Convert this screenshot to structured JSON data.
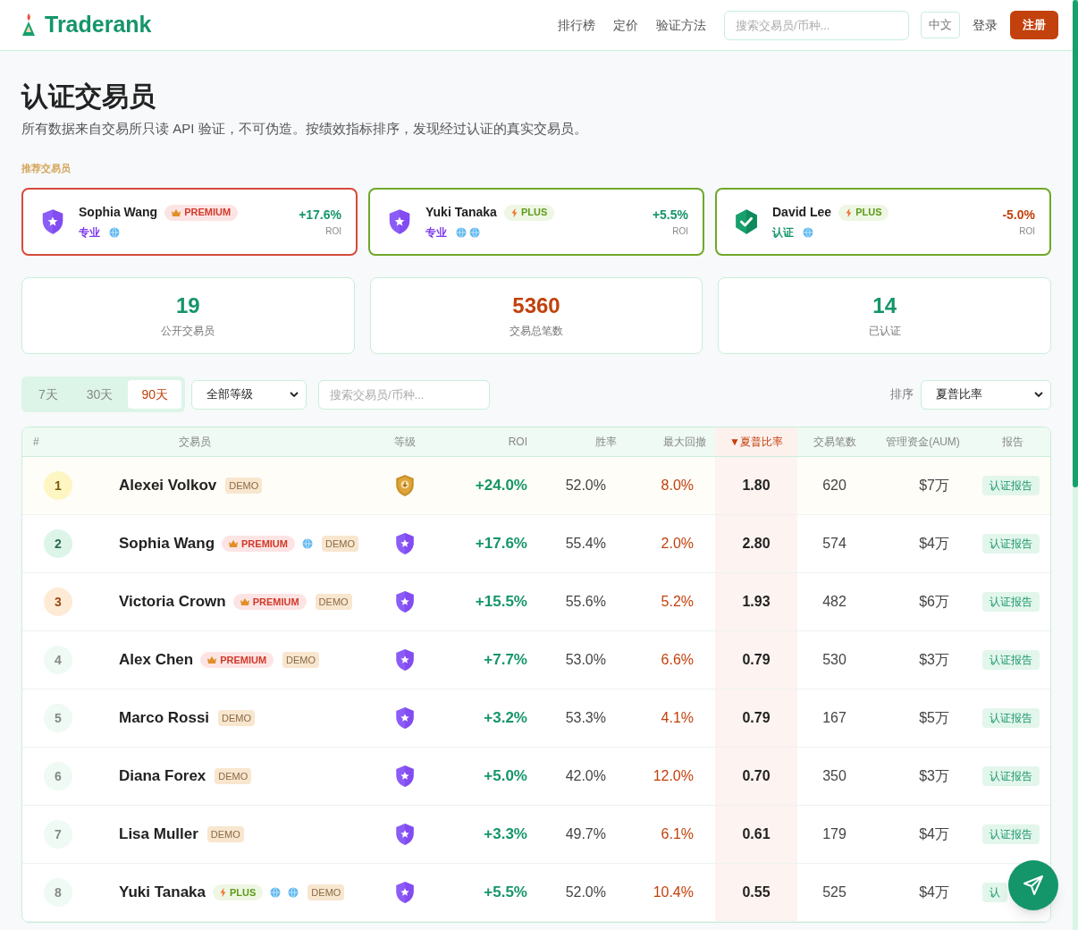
{
  "header": {
    "logo": "Traderank",
    "nav": [
      "排行榜",
      "定价",
      "验证方法"
    ],
    "search": {
      "placeholder": "搜索交易员/币种..."
    },
    "language": "中文",
    "login": "登录",
    "signup": "注册"
  },
  "page": {
    "title": "认证交易员",
    "subtitle": "所有数据来自交易所只读 API 验证，不可伪造。按绩效指标排序，发现经过认证的真实交易员。"
  },
  "featured": {
    "label": "推荐交易员",
    "cards": [
      {
        "name": "Sophia Wang",
        "badge": {
          "kind": "premium",
          "label": "PREMIUM"
        },
        "tier": {
          "kind": "pro",
          "label": "专业"
        },
        "icons": [
          {
            "kind": "globe"
          }
        ],
        "roi": "+17.6%",
        "roi_label": "ROI",
        "negative": false
      },
      {
        "name": "Yuki Tanaka",
        "badge": {
          "kind": "plus",
          "label": "PLUS"
        },
        "tier": {
          "kind": "pro",
          "label": "专业"
        },
        "icons": [
          {
            "kind": "globe"
          },
          {
            "kind": "globe"
          }
        ],
        "roi": "+5.5%",
        "roi_label": "ROI",
        "negative": false
      },
      {
        "name": "David Lee",
        "badge": {
          "kind": "plus",
          "label": "PLUS"
        },
        "tier": {
          "kind": "verified",
          "label": "认证"
        },
        "icons": [
          {
            "kind": "globe"
          }
        ],
        "roi": "-5.0%",
        "roi_label": "ROI",
        "negative": true
      }
    ]
  },
  "stats": [
    {
      "value": "19",
      "label": "公开交易员",
      "color": "#15956a"
    },
    {
      "value": "5360",
      "label": "交易总笔数",
      "color": "#c2410c"
    },
    {
      "value": "14",
      "label": "已认证",
      "color": "#15956a"
    }
  ],
  "filters": {
    "period_tabs": [
      {
        "label": "7天",
        "selected": false
      },
      {
        "label": "30天",
        "selected": false
      },
      {
        "label": "90天",
        "selected": true
      }
    ],
    "level_select": "全部等级",
    "search": {
      "placeholder": "搜索交易员/币种..."
    },
    "sort_label": "排序",
    "sort_select": "夏普比率"
  },
  "table": {
    "sort_mark": "▼",
    "columns": [
      {
        "label": "#",
        "sorted": false
      },
      {
        "label": "交易员",
        "sorted": false
      },
      {
        "label": "等级",
        "sorted": false
      },
      {
        "label": "ROI",
        "sorted": false
      },
      {
        "label": "胜率",
        "sorted": false
      },
      {
        "label": "最大回撤",
        "sorted": false
      },
      {
        "label": "夏普比率",
        "sorted": true
      },
      {
        "label": "交易笔数",
        "sorted": false
      },
      {
        "label": "管理资金(AUM)",
        "sorted": false
      },
      {
        "label": "报告",
        "sorted": false
      }
    ],
    "rows": [
      {
        "rank": "1",
        "name": "Alexei Volkov",
        "tags": [
          {
            "kind": "demo",
            "label": "DEMO"
          }
        ],
        "tier": {
          "kind": "gold"
        },
        "roi": "+24.0%",
        "win_rate": "52.0%",
        "max_drawdown": "8.0%",
        "sharpe": "1.80",
        "trades": "620",
        "aum": "$7万",
        "report": "认证报告"
      },
      {
        "rank": "2",
        "name": "Sophia Wang",
        "tags": [
          {
            "kind": "premium",
            "label": "PREMIUM"
          },
          {
            "kind": "globe"
          },
          {
            "kind": "demo",
            "label": "DEMO"
          }
        ],
        "tier": {
          "kind": "pro"
        },
        "roi": "+17.6%",
        "win_rate": "55.4%",
        "max_drawdown": "2.0%",
        "sharpe": "2.80",
        "trades": "574",
        "aum": "$4万",
        "report": "认证报告"
      },
      {
        "rank": "3",
        "name": "Victoria Crown",
        "tags": [
          {
            "kind": "premium",
            "label": "PREMIUM"
          },
          {
            "kind": "demo",
            "label": "DEMO"
          }
        ],
        "tier": {
          "kind": "pro"
        },
        "roi": "+15.5%",
        "win_rate": "55.6%",
        "max_drawdown": "5.2%",
        "sharpe": "1.93",
        "trades": "482",
        "aum": "$6万",
        "report": "认证报告"
      },
      {
        "rank": "4",
        "name": "Alex Chen",
        "tags": [
          {
            "kind": "premium",
            "label": "PREMIUM"
          },
          {
            "kind": "demo",
            "label": "DEMO"
          }
        ],
        "tier": {
          "kind": "pro"
        },
        "roi": "+7.7%",
        "win_rate": "53.0%",
        "max_drawdown": "6.6%",
        "sharpe": "0.79",
        "trades": "530",
        "aum": "$3万",
        "report": "认证报告"
      },
      {
        "rank": "5",
        "name": "Marco Rossi",
        "tags": [
          {
            "kind": "demo",
            "label": "DEMO"
          }
        ],
        "tier": {
          "kind": "pro"
        },
        "roi": "+3.2%",
        "win_rate": "53.3%",
        "max_drawdown": "4.1%",
        "sharpe": "0.79",
        "trades": "167",
        "aum": "$5万",
        "report": "认证报告"
      },
      {
        "rank": "6",
        "name": "Diana Forex",
        "tags": [
          {
            "kind": "demo",
            "label": "DEMO"
          }
        ],
        "tier": {
          "kind": "pro"
        },
        "roi": "+5.0%",
        "win_rate": "42.0%",
        "max_drawdown": "12.0%",
        "sharpe": "0.70",
        "trades": "350",
        "aum": "$3万",
        "report": "认证报告"
      },
      {
        "rank": "7",
        "name": "Lisa Muller",
        "tags": [
          {
            "kind": "demo",
            "label": "DEMO"
          }
        ],
        "tier": {
          "kind": "pro"
        },
        "roi": "+3.3%",
        "win_rate": "49.7%",
        "max_drawdown": "6.1%",
        "sharpe": "0.61",
        "trades": "179",
        "aum": "$4万",
        "report": "认证报告"
      },
      {
        "rank": "8",
        "name": "Yuki Tanaka",
        "tags": [
          {
            "kind": "plus",
            "label": "PLUS"
          },
          {
            "kind": "globe"
          },
          {
            "kind": "globe"
          },
          {
            "kind": "demo",
            "label": "DEMO"
          }
        ],
        "tier": {
          "kind": "pro"
        },
        "roi": "+5.5%",
        "win_rate": "52.0%",
        "max_drawdown": "10.4%",
        "sharpe": "0.55",
        "trades": "525",
        "aum": "$4万",
        "report": "认"
      }
    ]
  }
}
